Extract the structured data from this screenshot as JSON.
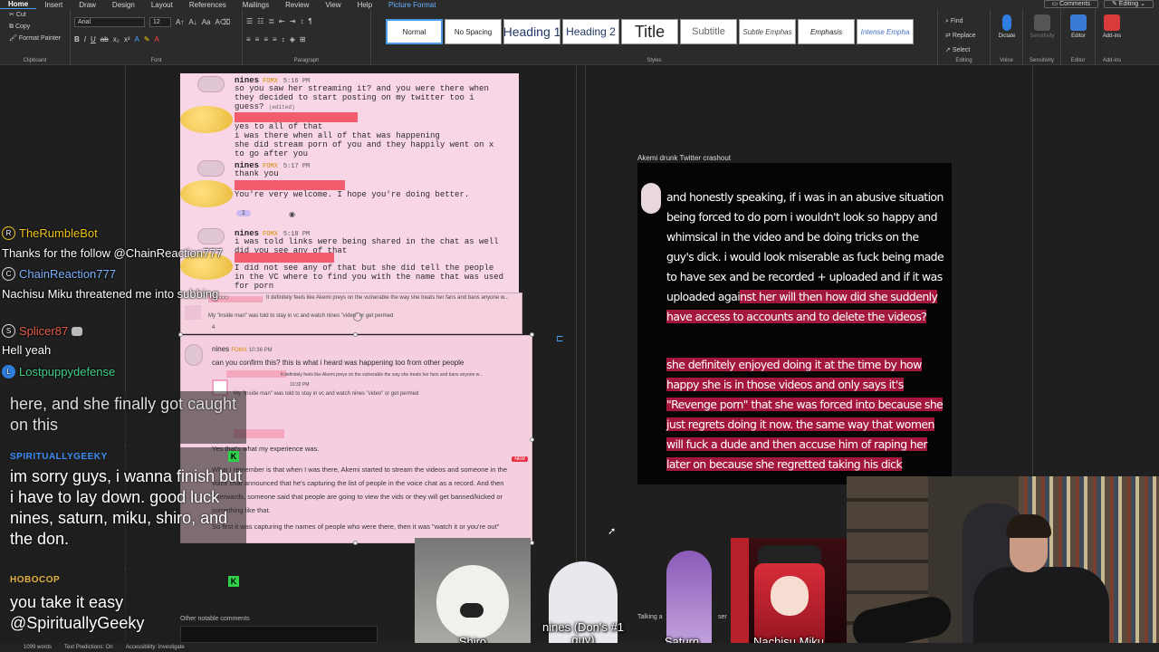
{
  "ribbon": {
    "tabs": [
      "Home",
      "Insert",
      "Draw",
      "Design",
      "Layout",
      "References",
      "Mailings",
      "Review",
      "View",
      "Help",
      "Picture Format"
    ],
    "comments_label": "Comments",
    "editing_label": "Editing",
    "clipboard": {
      "cut": "Cut",
      "copy": "Copy",
      "format_painter": "Format Painter",
      "group": "Clipboard"
    },
    "font": {
      "family": "Arial",
      "size": "12",
      "group": "Font"
    },
    "paragraph_group": "Paragraph",
    "styles_group": "Styles",
    "styles": [
      "Normal",
      "No Spacing",
      "Heading 1",
      "Heading 2",
      "Title",
      "Subtitle",
      "Subtle Emphas",
      "Emphasis",
      "Intense Empha"
    ],
    "editing": {
      "find": "Find",
      "replace": "Replace",
      "select": "Select",
      "group": "Editing"
    },
    "voice": {
      "dictate": "Dictate",
      "group": "Voice"
    },
    "sensitivity": {
      "label": "Sensitivity",
      "group": "Sensitivity"
    },
    "editor": {
      "label": "Editor",
      "group": "Editor"
    },
    "addins": {
      "label": "Add-ins",
      "group": "Add-ins"
    }
  },
  "document": {
    "caption": "Akemi drunk Twitter crashout",
    "other_comments": "Other notable comments"
  },
  "status_bar": [
    "1099 words",
    "Text Predictions: On",
    "Accessibility: Investigate"
  ],
  "discord1": {
    "messages": [
      {
        "user": "nines",
        "tag": "FOMX",
        "time": "5:16 PM",
        "text": "so you saw her streaming it? and you were there when they decided to start posting on my twitter too i guess?",
        "edited": "(edited)"
      },
      {
        "reply": "yes to all of that\ni was there when all of that was happening\nshe did stream porn of you and they happily went on x to go after you"
      },
      {
        "user": "nines",
        "tag": "FOMX",
        "time": "5:17 PM",
        "text": "thank you"
      },
      {
        "reply": "You're very welcome. I hope you're doing better.",
        "reaction": "1"
      },
      {
        "user": "nines",
        "tag": "FOMX",
        "time": "5:18 PM",
        "text": "i was told links were being shared in the chat as well did you see any of that"
      },
      {
        "reply": "I did not see any of that but she did tell the people in the VC where to find you with the name that was used for porn"
      }
    ]
  },
  "discord2": {
    "quote": "It definitely feels like Akemi preys on the vulnerable the way she treats her fans and bans anyone w...",
    "text": "My \"inside man\" was told to stay in vc and watch nines \"video\" or get permed",
    "reaction": "4"
  },
  "discord3": {
    "user": "nines",
    "tag": "FOMX",
    "time": "10:36 PM",
    "text": "can you confirm this? this is what i heard was happening too from other people",
    "quote": "It definitely feels like Akemi preys on the vulnerable the way she treats her fans and bans anyone w...",
    "quote_time": "10:32 PM",
    "quote_text": "My \"inside man\" was told to stay in vc and watch nines \"video\" or get permed",
    "reply1": "Yes that's what my experience was.",
    "new_badge": "NEW",
    "reply2": "What I remember is that when I was there, Akemi started to stream the videos and someone in the voice chat announced that he's capturing the list of people in the voice chat as a record. And then afterwards, someone said that people are going to view the vids or they will get banned/kicked or something like that.",
    "reply3": "So first it was capturing the names of people who were there, then it was \"watch it or you're out\""
  },
  "tweet": {
    "para1_plain": "and honestly speaking, if i was in an abusive situation being forced to do porn i wouldn't look so happy and whimsical in the video and be doing tricks on the guy's dick. i would look miserable as fuck being made to have sex and be recorded + uploaded and if it was uploaded agai",
    "para1_hl": "nst her will then how did she suddenly have access to accounts and to delete the videos?",
    "para2": "she definitely enjoyed doing it at the time by how happy she is in those videos and only says it's \"Revenge porn\" that she was forced into because she just regrets doing it now. the same way that women will fuck a dude and then accuse him of raping her later on because she regretted taking his dick"
  },
  "chat": {
    "top": [
      {
        "user": "TheRumbleBot",
        "color": "#f0c419",
        "badge": "R",
        "msg": "Thanks for the follow @ChainReaction777"
      },
      {
        "user": "ChainReaction777",
        "color": "#7fb2ff",
        "badge": "C",
        "msg": "Nachisu Miku threatened me into subbing..."
      },
      {
        "user": "Splicer87",
        "color": "#e8604c",
        "badge": "S",
        "msg": "Hell yeah"
      },
      {
        "user": "Lostpuppydefense",
        "color": "#43d18a",
        "badge": "L",
        "msg": ""
      }
    ],
    "big": [
      {
        "user": "",
        "color": "#e0c070",
        "msg": "here, and she finally got caught on this"
      },
      {
        "user": "SPIRITUALLYGEEKY",
        "color": "#3b8bf5",
        "msg": "im sorry guys, i wanna finish but i have to lay down. good luck nines, saturn, miku, shiro, and the don."
      },
      {
        "user": "HOBOCOP",
        "color": "#e0b040",
        "msg": "you take it easy @SpirituallyGeeky"
      }
    ],
    "kick_badge": "K"
  },
  "vtubers": [
    {
      "name": "Shiro"
    },
    {
      "name": "nines (Don's #1 guy)"
    },
    {
      "name": "Saturn"
    },
    {
      "name": "Nachisu Miku"
    }
  ],
  "misc": {
    "talking": "Talking a",
    "ser": "ser"
  },
  "colors": {
    "accent": "#4a9be8",
    "tweet_highlight": "#a4173d",
    "discord_pink": "#f8d6e6",
    "red_bar": "#f25c6c"
  }
}
